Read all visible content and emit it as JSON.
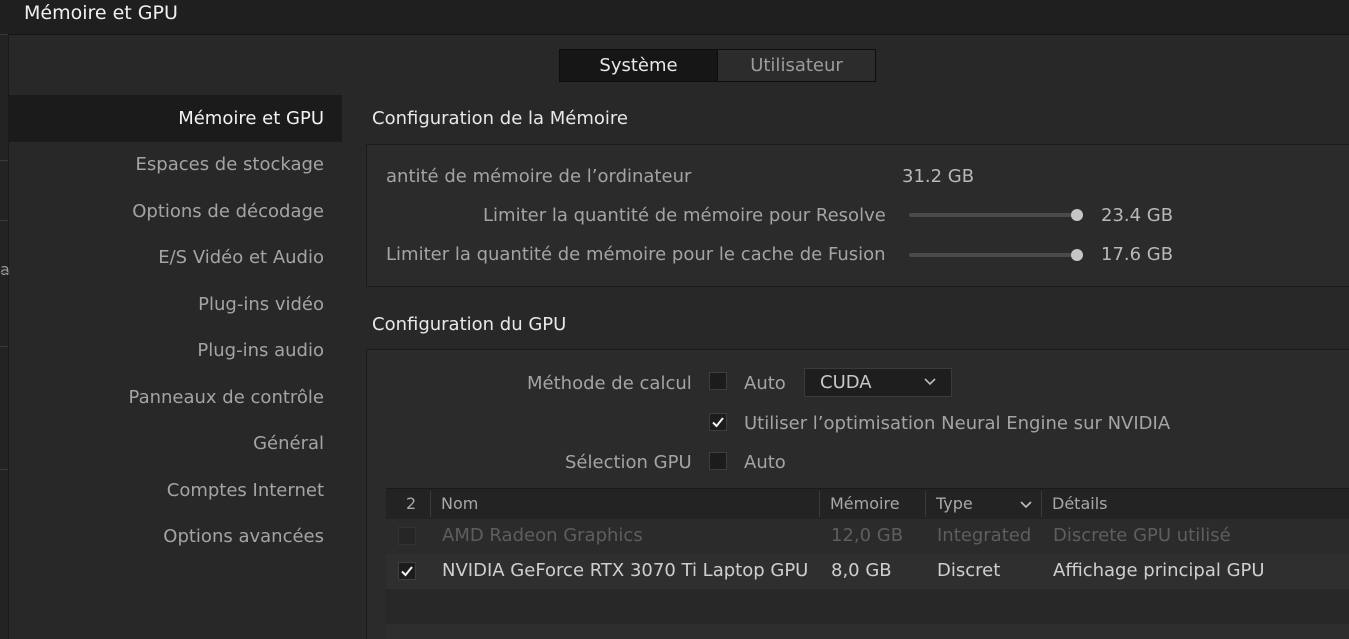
{
  "window": {
    "title": "Mémoire et GPU"
  },
  "tabs": [
    {
      "label": "Système",
      "active": true
    },
    {
      "label": "Utilisateur",
      "active": false
    }
  ],
  "left_fragment": "a",
  "sidebar": {
    "items": [
      {
        "label": "Mémoire et GPU",
        "active": true
      },
      {
        "label": "Espaces de stockage"
      },
      {
        "label": "Options de décodage"
      },
      {
        "label": "E/S Vidéo et Audio"
      },
      {
        "label": "Plug-ins vidéo"
      },
      {
        "label": "Plug-ins audio"
      },
      {
        "label": "Panneaux de contrôle"
      },
      {
        "label": "Général"
      },
      {
        "label": "Comptes Internet"
      },
      {
        "label": "Options avancées"
      }
    ]
  },
  "memory": {
    "section_title": "Configuration de la Mémoire",
    "system_label": "antité de mémoire de l’ordinateur",
    "system_value": "31.2 GB",
    "resolve_label": "Limiter la quantité de mémoire pour Resolve",
    "resolve_value": "23.4 GB",
    "resolve_fraction": 1.0,
    "fusion_label": "Limiter la quantité de mémoire pour le cache de Fusion",
    "fusion_value": "17.6 GB",
    "fusion_fraction": 1.0
  },
  "gpu": {
    "section_title": "Configuration du GPU",
    "method_label": "Méthode de calcul",
    "method_auto_label": "Auto",
    "method_auto_checked": false,
    "method_value": "CUDA",
    "neural_label": "Utiliser l’optimisation Neural Engine sur NVIDIA",
    "neural_checked": true,
    "selection_label": "Sélection GPU",
    "selection_auto_label": "Auto",
    "selection_auto_checked": false,
    "table": {
      "columns": [
        "2",
        "Nom",
        "Mémoire",
        "Type",
        "Détails"
      ],
      "rows": [
        {
          "checked": false,
          "enabled": false,
          "name": "AMD Radeon Graphics",
          "memory": "12,0 GB",
          "type": "Integrated",
          "details": "Discrete GPU utilisé"
        },
        {
          "checked": true,
          "enabled": true,
          "name": "NVIDIA GeForce RTX 3070 Ti Laptop GPU",
          "memory": "8,0 GB",
          "type": "Discret",
          "details": "Affichage principal GPU"
        }
      ]
    }
  }
}
